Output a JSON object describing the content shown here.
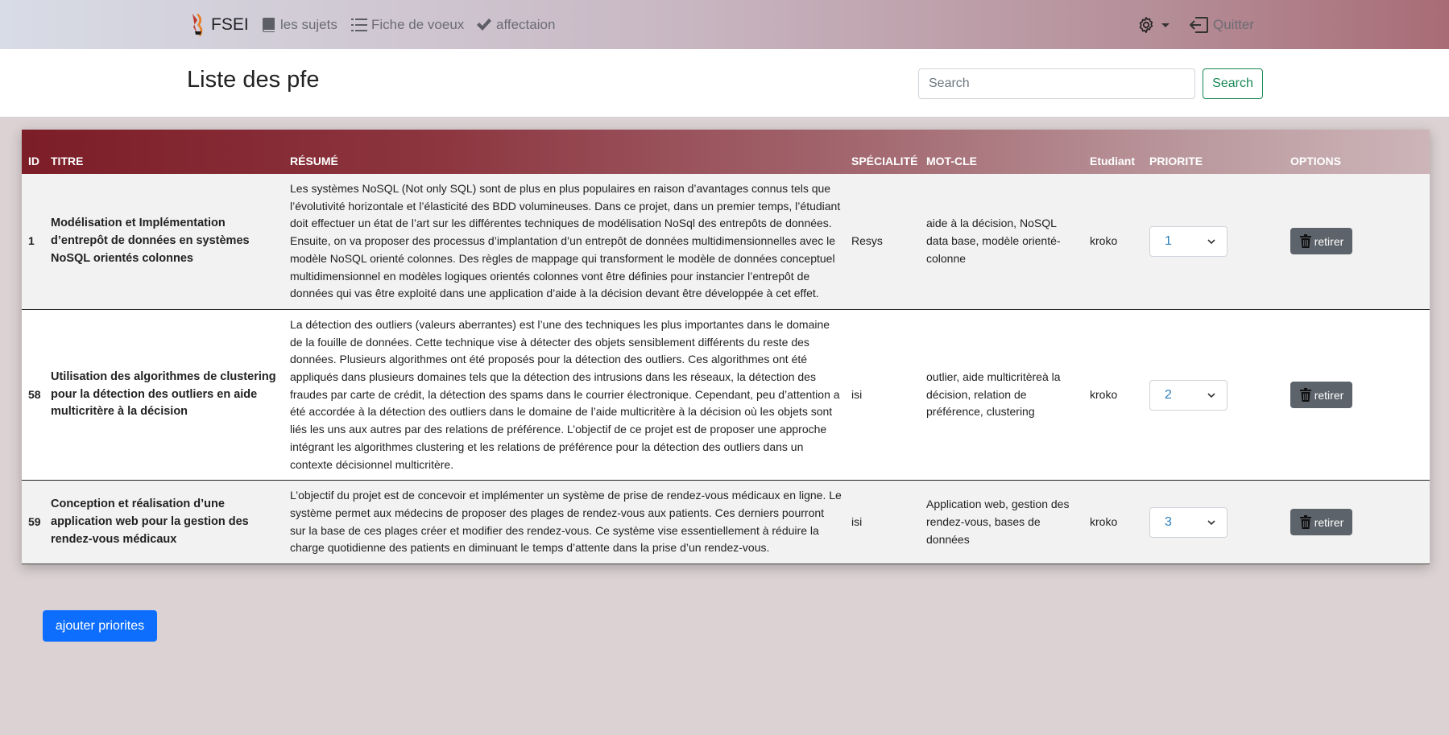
{
  "navbar": {
    "brand": "FSEI",
    "links": [
      {
        "label": "les sujets",
        "icon": "book-icon"
      },
      {
        "label": "Fiche de voeux",
        "icon": "list-icon"
      },
      {
        "label": "affectaion",
        "icon": "check-icon"
      }
    ],
    "settings_icon": "gear-icon",
    "quit_label": "Quitter"
  },
  "header": {
    "title": "Liste des pfe",
    "search_placeholder": "Search",
    "search_button": "Search"
  },
  "table": {
    "columns": [
      "ID",
      "TITRE",
      "RÉSUMÉ",
      "SPÉCIALITÉ",
      "MOT-CLE",
      "Etudiant",
      "PRIORITE",
      "OPTIONS"
    ],
    "rows": [
      {
        "id": "1",
        "title": "Modélisation et Implémentation d’entrepôt de données en systèmes NoSQL orientés colonnes",
        "summary": "Les systèmes NoSQL (Not only SQL) sont de plus en plus populaires en raison d’avantages connus tels que l’évolutivité horizontale et l’élasticité des BDD volumineuses. Dans ce projet, dans un premier temps, l’étudiant doit effectuer un état de l’art sur les différentes techniques de modélisation NoSql des entrepôts de données. Ensuite, on va proposer des processus d’implantation d’un entrepôt de données multidimensionnelles avec le modèle NoSQL orienté colonnes. Des règles de mappage qui transforment le modèle de données conceptuel multidimensionnel en modèles logiques orientés colonnes vont être définies pour instancier l’entrepôt de données qui vas être exploité dans une application d’aide à la décision devant être développée à cet effet.",
        "speciality": "Resys",
        "keywords": "aide à la décision, NoSQL data base, modèle orienté-colonne",
        "student": "kroko",
        "priority": "1",
        "option_label": "retirer"
      },
      {
        "id": "58",
        "title": "Utilisation des algorithmes de clustering pour la détection des outliers en aide multicritère à la décision",
        "summary": "La détection des outliers (valeurs aberrantes) est l’une des techniques les plus importantes dans le domaine de la fouille de données. Cette technique vise à détecter des objets sensiblement différents du reste des données. Plusieurs algorithmes ont été proposés pour la détection des outliers. Ces algorithmes ont été appliqués dans plusieurs domaines tels que la détection des intrusions dans les réseaux, la détection des fraudes par carte de crédit, la détection des spams dans le courrier électronique. Cependant, peu d’attention a été accordée à la détection des outliers dans le domaine de l’aide multicritère à la décision où les objets sont liés les uns aux autres par des relations de préférence. L’objectif de ce projet est de proposer une approche intégrant les algorithmes clustering et les relations de préférence pour la détection des outliers dans un contexte décisionnel multicritère.",
        "speciality": "isi",
        "keywords": "outlier, aide multicritèreà la décision, relation de préférence, clustering",
        "student": "kroko",
        "priority": "2",
        "option_label": "retirer"
      },
      {
        "id": "59",
        "title": "Conception et réalisation d’une application web pour la gestion des rendez-vous médicaux",
        "summary": "L’objectif du projet est de concevoir et implémenter un système de prise de rendez-vous médicaux en ligne. Le système permet aux médecins de proposer des plages de rendez-vous aux patients. Ces derniers pourront sur la base de ces plages créer et modifier des rendez-vous. Ce système vise essentiellement à réduire la charge quotidienne des patients en diminuant le temps d’attente dans la prise d’un rendez-vous.",
        "speciality": "isi",
        "keywords": "Application web, gestion des rendez-vous, bases de données",
        "student": "kroko",
        "priority": "3",
        "option_label": "retirer"
      }
    ]
  },
  "footer": {
    "add_button": "ajouter priorites"
  },
  "colors": {
    "header_gradient_start": "#7c1d27",
    "search_green": "#198754",
    "primary_blue": "#0d6efd",
    "retirer_gray": "#5c636a",
    "select_text": "#2c7fb8"
  }
}
